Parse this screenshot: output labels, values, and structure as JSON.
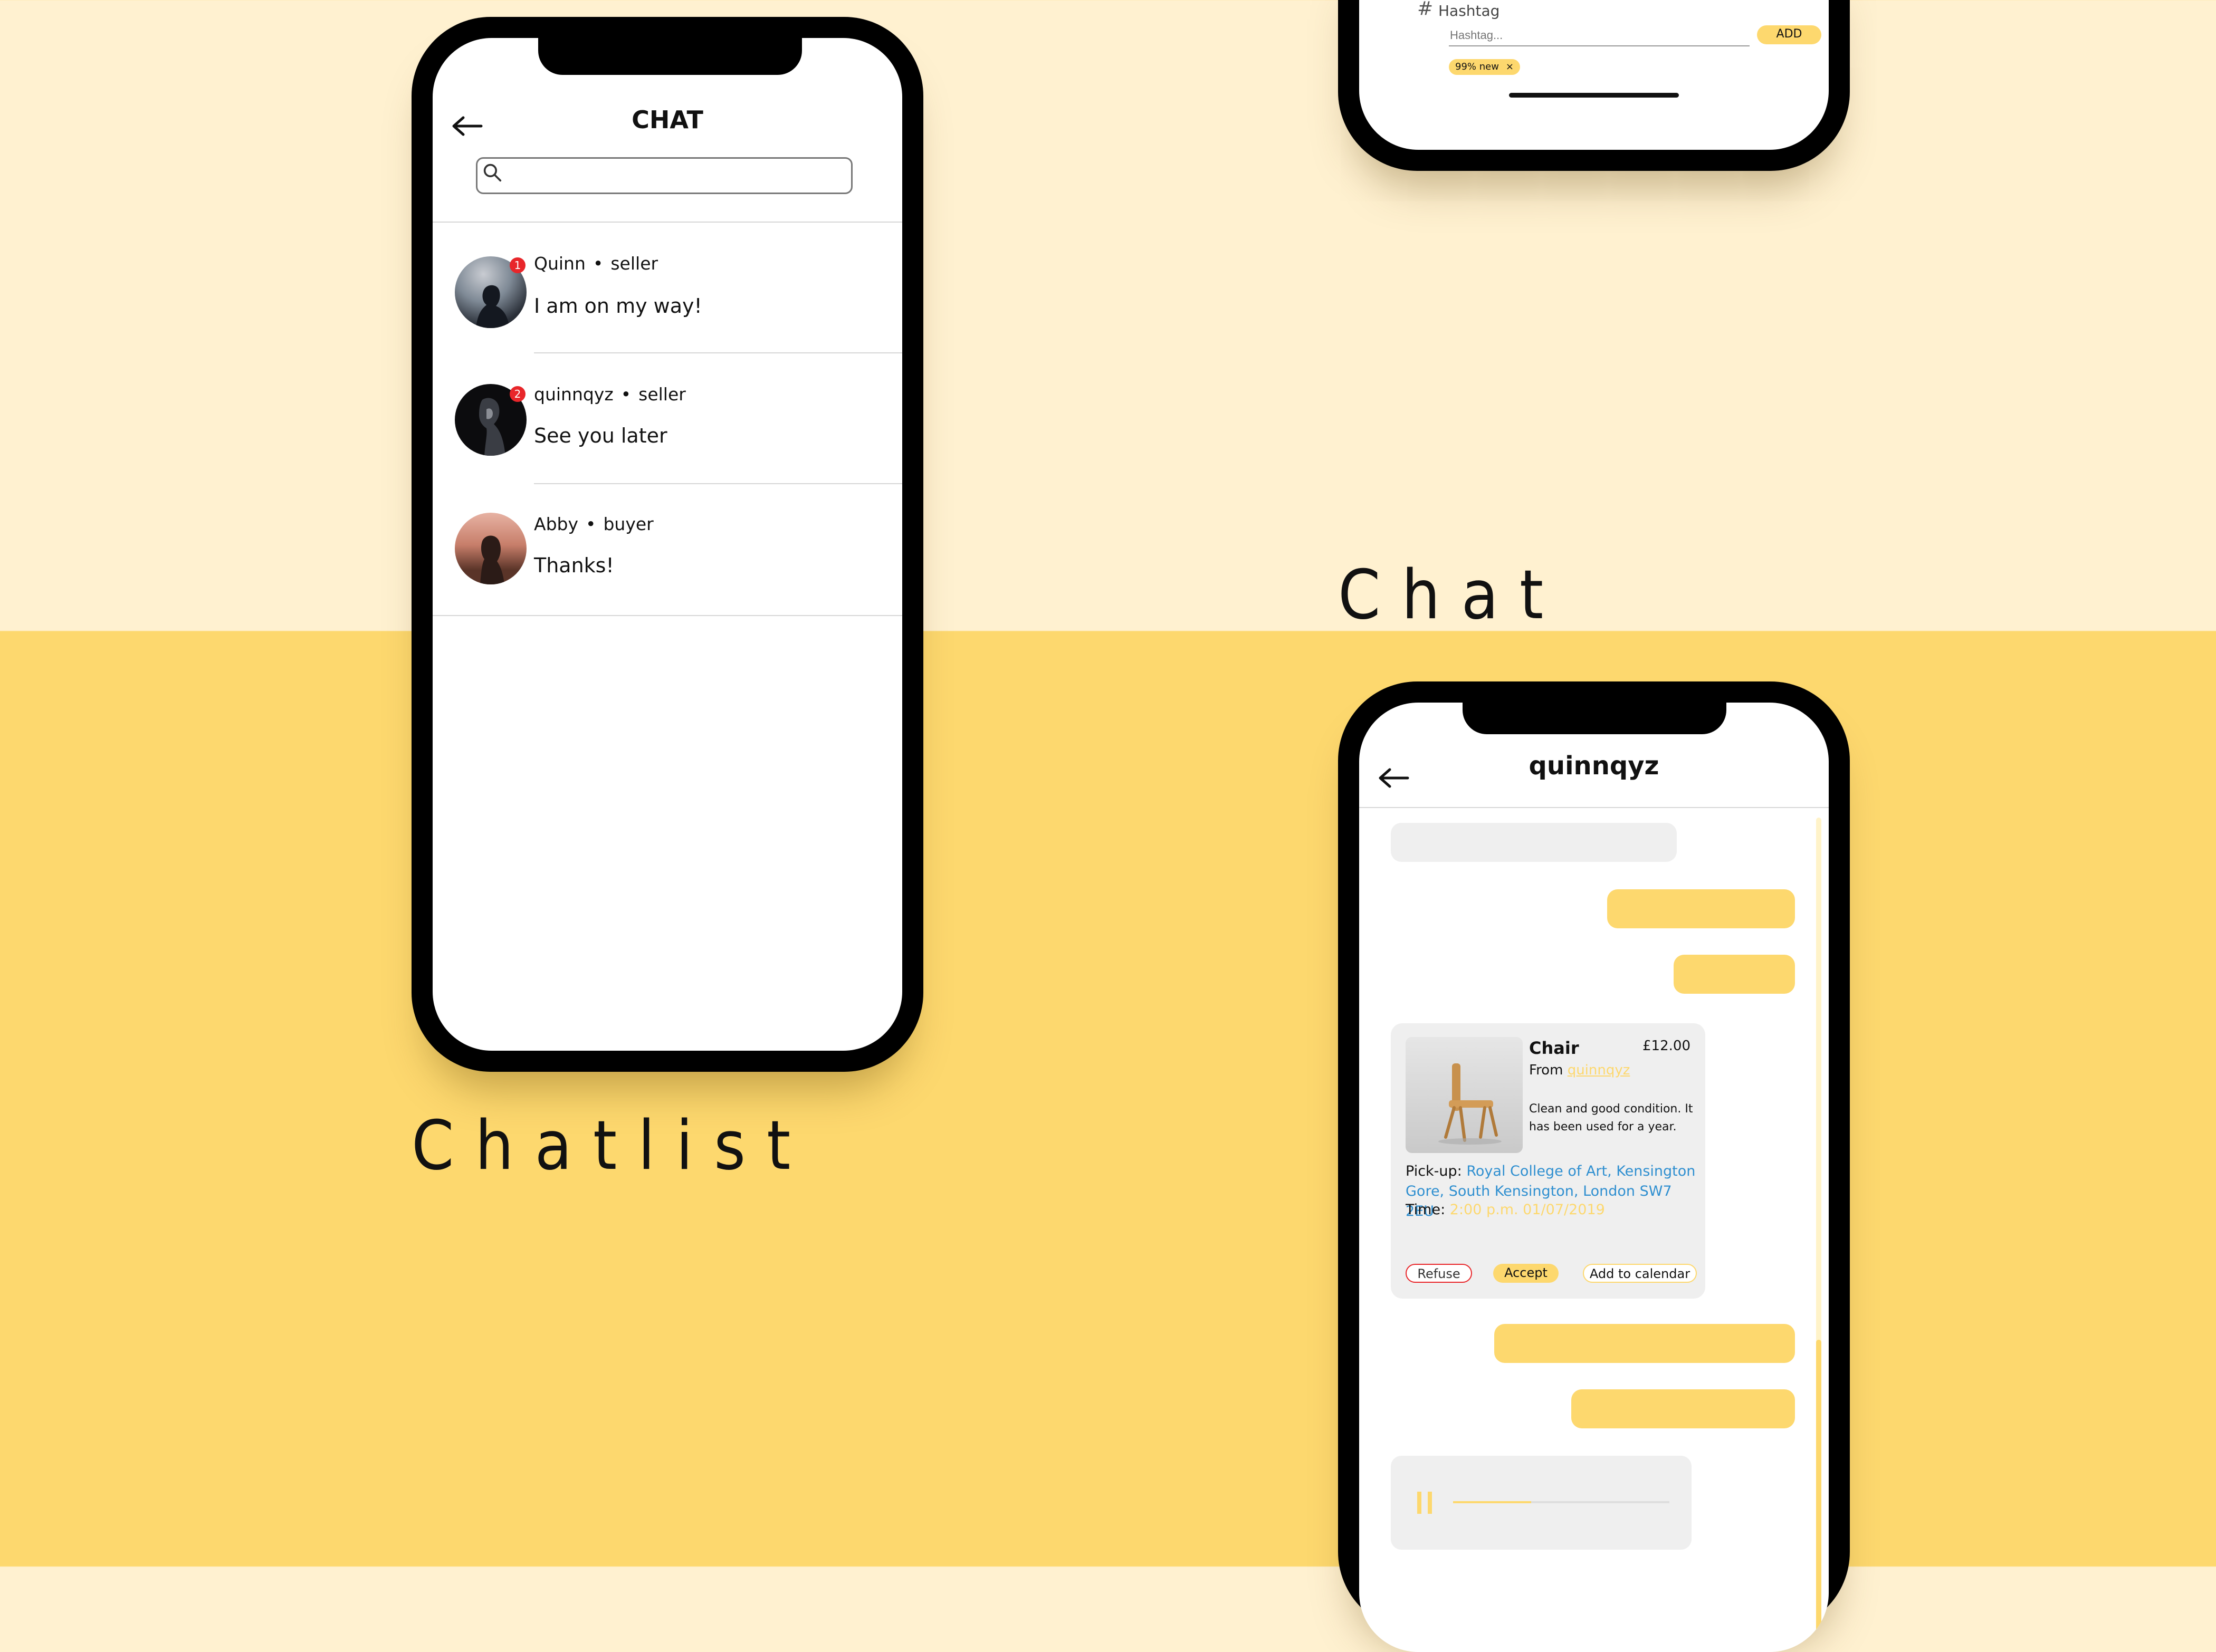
{
  "chatlist_screen": {
    "title": "CHAT",
    "search_placeholder": "",
    "conversations": [
      {
        "name": "Quinn",
        "role": "seller",
        "message": "I am on my way!",
        "unread": "1"
      },
      {
        "name": "quinnqyz",
        "role": "seller",
        "message": "See you later",
        "unread": "2"
      },
      {
        "name": "Abby",
        "role": "buyer",
        "message": "Thanks!",
        "unread": ""
      }
    ]
  },
  "hashtag_panel": {
    "label": "Hashtag",
    "input_placeholder": "Hashtag...",
    "add_label": "ADD",
    "tag_label": "99% new"
  },
  "chat_screen": {
    "title": "quinnqyz",
    "item": {
      "name": "Chair",
      "price": "£12.00",
      "from_label": "From",
      "from_user": "quinnqyz",
      "description": "Clean and good condition. It has been used for a year.",
      "pickup_label": "Pick-up:",
      "pickup_address": "Royal College of Art, Kensington Gore, South Kensington, London SW7 2EU",
      "time_label": "Time:",
      "time_value": "2:00 p.m. 01/07/2019"
    },
    "actions": {
      "refuse": "Refuse",
      "accept": "Accept",
      "calendar": "Add to calendar"
    },
    "voice_progress": 0.36
  },
  "captions": {
    "chatlist": "Chatlist",
    "chat": "Chat"
  },
  "colors": {
    "accent": "#fdd86e",
    "light_background": "#fff1d0",
    "unread_badge": "#e8262a",
    "link": "#2f8fd0"
  }
}
